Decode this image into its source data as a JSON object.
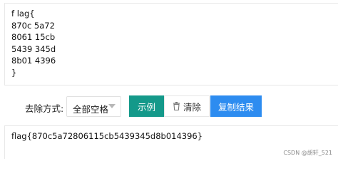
{
  "input": {
    "text": "f lag{\n870c 5a72\n8061 15cb\n5439 345d\n8b01 4396\n}"
  },
  "toolbar": {
    "remove_label": "去除方式:",
    "select_value": "全部空格",
    "example_label": "示例",
    "clear_label": "清除",
    "copy_label": "复制结果"
  },
  "output": {
    "text": "flag{870c5a72806115cb5439345d8b014396}"
  },
  "watermark": "CSDN @胡轩_521",
  "icons": {
    "caret": "chevron-down-icon",
    "clear": "trash-icon"
  },
  "colors": {
    "example_button": "#14998a",
    "copy_button": "#2d8cf0"
  }
}
